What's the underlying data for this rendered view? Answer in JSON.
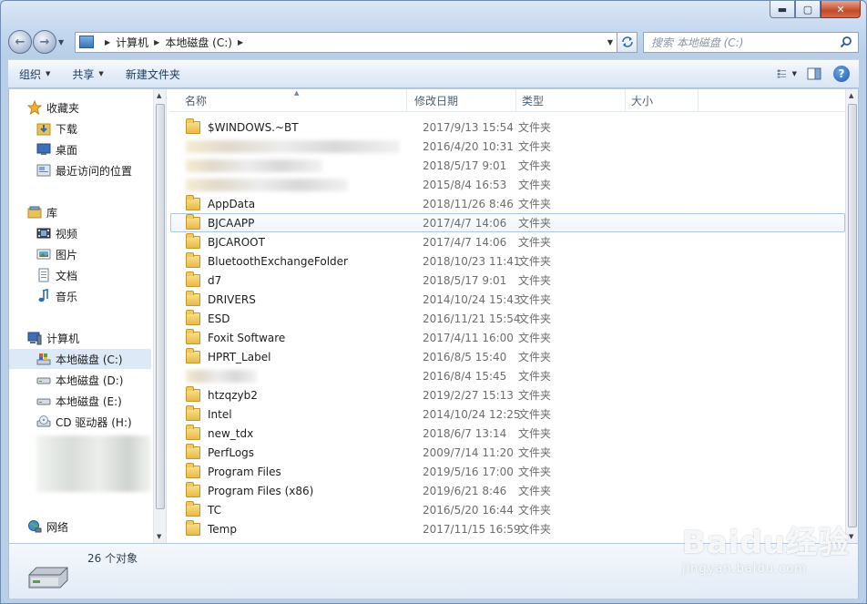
{
  "window": {
    "caption_buttons": {
      "minimize": "▬",
      "maximize": "▢",
      "close": "✕"
    }
  },
  "navbar": {
    "breadcrumb": [
      "计算机",
      "本地磁盘 (C:)"
    ],
    "search_placeholder": "搜索 本地磁盘 (C:)"
  },
  "toolbar": {
    "organize": "组织",
    "share": "共享",
    "new_folder": "新建文件夹",
    "help": "?"
  },
  "nav_pane": {
    "favorites": {
      "label": "收藏夹",
      "items": [
        "下载",
        "桌面",
        "最近访问的位置"
      ]
    },
    "libraries": {
      "label": "库",
      "items": [
        "视频",
        "图片",
        "文档",
        "音乐"
      ]
    },
    "computer": {
      "label": "计算机",
      "items": [
        "本地磁盘 (C:)",
        "本地磁盘 (D:)",
        "本地磁盘 (E:)",
        "CD 驱动器 (H:)"
      ]
    },
    "network": {
      "label": "网络"
    }
  },
  "columns": {
    "name": "名称",
    "date": "修改日期",
    "type": "类型",
    "size": "大小"
  },
  "files": [
    {
      "name": "$WINDOWS.~BT",
      "date": "2017/9/13 15:54",
      "type": "文件夹"
    },
    {
      "name": "",
      "date": "2016/4/20 10:31",
      "type": "文件夹",
      "blurred": true
    },
    {
      "name": "",
      "date": "2018/5/17 9:01",
      "type": "文件夹",
      "blurred": true
    },
    {
      "name": "",
      "date": "2015/8/4 16:53",
      "type": "文件夹",
      "blurred": true
    },
    {
      "name": "AppData",
      "date": "2018/11/26 8:46",
      "type": "文件夹"
    },
    {
      "name": "BJCAAPP",
      "date": "2017/4/7 14:06",
      "type": "文件夹",
      "hover": true
    },
    {
      "name": "BJCAROOT",
      "date": "2017/4/7 14:06",
      "type": "文件夹"
    },
    {
      "name": "BluetoothExchangeFolder",
      "date": "2018/10/23 11:41",
      "type": "文件夹"
    },
    {
      "name": "d7",
      "date": "2018/5/17 9:01",
      "type": "文件夹"
    },
    {
      "name": "DRIVERS",
      "date": "2014/10/24 15:43",
      "type": "文件夹"
    },
    {
      "name": "ESD",
      "date": "2016/11/21 15:54",
      "type": "文件夹"
    },
    {
      "name": "Foxit Software",
      "date": "2017/4/11 16:00",
      "type": "文件夹"
    },
    {
      "name": "HPRT_Label",
      "date": "2016/8/5 15:40",
      "type": "文件夹"
    },
    {
      "name": "",
      "date": "2016/8/4 15:45",
      "type": "文件夹",
      "blurred": true
    },
    {
      "name": "htzqzyb2",
      "date": "2019/2/27 15:13",
      "type": "文件夹"
    },
    {
      "name": "Intel",
      "date": "2014/10/24 12:25",
      "type": "文件夹"
    },
    {
      "name": "new_tdx",
      "date": "2018/6/7 13:14",
      "type": "文件夹"
    },
    {
      "name": "PerfLogs",
      "date": "2009/7/14 11:20",
      "type": "文件夹"
    },
    {
      "name": "Program Files",
      "date": "2019/5/16 17:00",
      "type": "文件夹"
    },
    {
      "name": "Program Files (x86)",
      "date": "2019/6/21 8:46",
      "type": "文件夹"
    },
    {
      "name": "TC",
      "date": "2016/5/20 16:44",
      "type": "文件夹"
    },
    {
      "name": "Temp",
      "date": "2017/11/15 16:59",
      "type": "文件夹"
    }
  ],
  "details": {
    "count": "26 个对象"
  },
  "watermark": {
    "brand": "Baidu经验",
    "url": "jingyan.baidu.com"
  }
}
